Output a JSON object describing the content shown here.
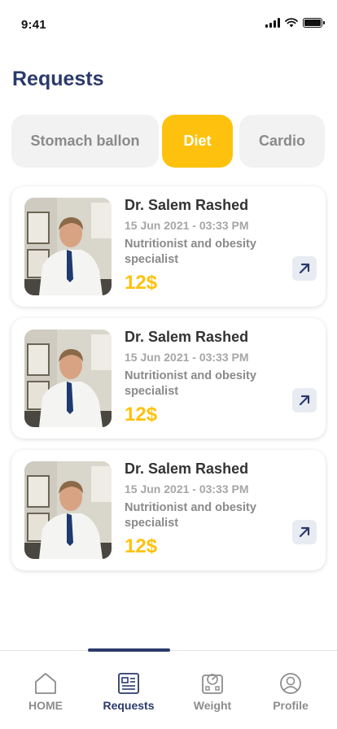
{
  "status": {
    "time": "9:41"
  },
  "page": {
    "title": "Requests"
  },
  "tabs": [
    {
      "label": "Stomach ballon",
      "active": false
    },
    {
      "label": "Diet",
      "active": true
    },
    {
      "label": "Cardio",
      "active": false
    }
  ],
  "requests": [
    {
      "name": "Dr. Salem Rashed",
      "datetime": "15 Jun 2021 - 03:33 PM",
      "specialty": "Nutritionist and obesity specialist",
      "price": "12$"
    },
    {
      "name": "Dr. Salem Rashed",
      "datetime": "15 Jun 2021 - 03:33 PM",
      "specialty": "Nutritionist and obesity specialist",
      "price": "12$"
    },
    {
      "name": "Dr. Salem Rashed",
      "datetime": "15 Jun 2021 - 03:33 PM",
      "specialty": "Nutritionist and obesity specialist",
      "price": "12$"
    }
  ],
  "nav": {
    "items": [
      {
        "label": "HOME",
        "icon": "home-icon",
        "active": false
      },
      {
        "label": "Requests",
        "icon": "requests-icon",
        "active": true
      },
      {
        "label": "Weight",
        "icon": "scale-icon",
        "active": false
      },
      {
        "label": "Profile",
        "icon": "profile-icon",
        "active": false
      }
    ]
  },
  "colors": {
    "accent": "#fec20e",
    "primary": "#2b3a6b",
    "tab_inactive_bg": "#f2f2f2",
    "muted_text": "#8a8a8a"
  }
}
